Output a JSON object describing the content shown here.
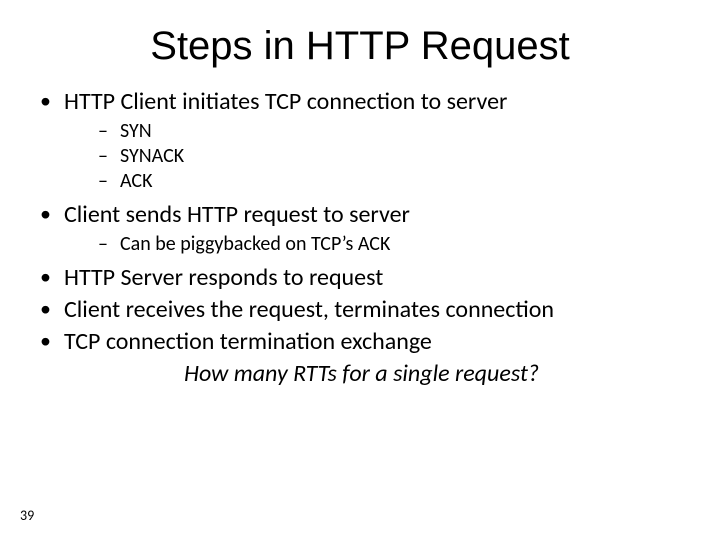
{
  "title": "Steps in HTTP Request",
  "bullets": {
    "b1": "HTTP Client initiates TCP connection to server",
    "b1_sub": {
      "s1": "SYN",
      "s2": "SYNACK",
      "s3": "ACK"
    },
    "b2": "Client sends HTTP request to server",
    "b2_sub": {
      "s1": "Can be piggybacked on TCP’s ACK"
    },
    "b3": "HTTP Server responds to request",
    "b4": "Client receives the request, terminates connection",
    "b5": "TCP connection termination exchange"
  },
  "question": "How many RTTs for a single request?",
  "page_number": "39"
}
